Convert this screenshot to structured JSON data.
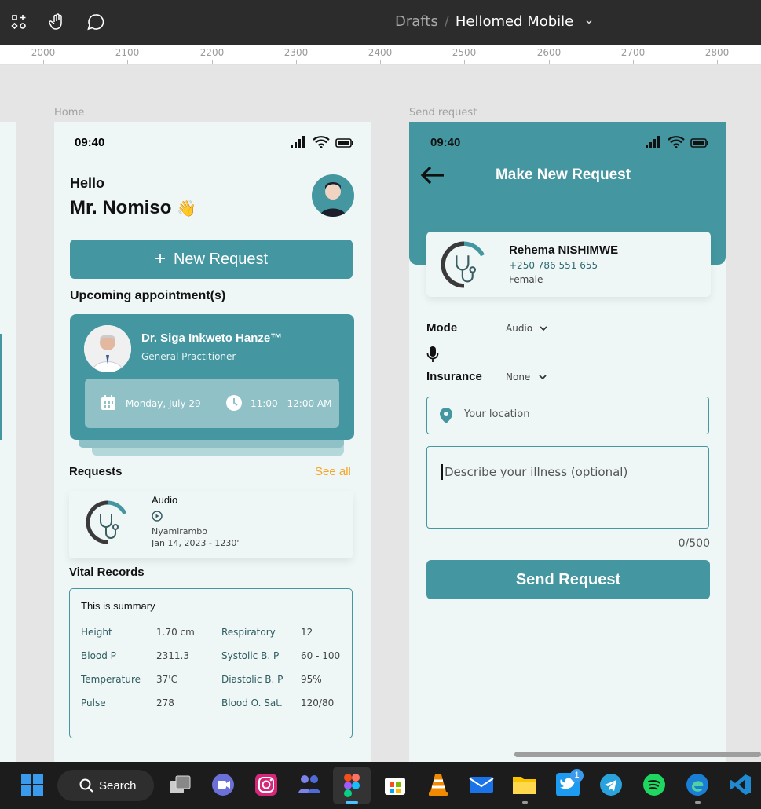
{
  "topbar": {
    "breadcrumb_drafts": "Drafts",
    "breadcrumb_sep": "/",
    "project_name": "Hellomed Mobile"
  },
  "ruler": {
    "ticks": [
      "2000",
      "2100",
      "2200",
      "2300",
      "2400",
      "2500",
      "2600",
      "2700",
      "2800"
    ]
  },
  "home": {
    "frame_label": "Home",
    "time": "09:40",
    "greeting": "Hello",
    "name": "Mr. Nomiso",
    "wave": "👋",
    "new_request_label": "New Request",
    "upcoming_title": "Upcoming appointment(s)",
    "doctor_name": "Dr. Siga Inkweto Hanze™",
    "doctor_role": "General Practitioner",
    "appt_date": "Monday, July 29",
    "appt_time": "11:00 - 12:00 AM",
    "requests_title": "Requests",
    "see_all": "See all",
    "request": {
      "type": "Audio",
      "location": "Nyamirambo",
      "datetime": "Jan 14, 2023 - 1230'"
    },
    "vitals_title": "Vital Records",
    "summary_title": "This is summary",
    "vitals": [
      {
        "label": "Height",
        "value": "1.70 cm",
        "label2": "Respiratory",
        "value2": "12"
      },
      {
        "label": "Blood P",
        "value": "2311.3",
        "label2": "Systolic B. P",
        "value2": "60 - 100"
      },
      {
        "label": "Temperature",
        "value": "37'C",
        "label2": "Diastolic B. P",
        "value2": "95%"
      },
      {
        "label": "Pulse",
        "value": "278",
        "label2": "Blood O. Sat.",
        "value2": "120/80"
      }
    ]
  },
  "send": {
    "frame_label": "Send request",
    "time": "09:40",
    "title": "Make New Request",
    "patient_name": "Rehema NISHIMWE",
    "patient_phone": "+250 786 551 655",
    "patient_gender": "Female",
    "mode_label": "Mode",
    "mode_value": "Audio",
    "insurance_label": "Insurance",
    "insurance_value": "None",
    "location_placeholder": "Your location",
    "illness_placeholder": "Describe your illness (optional)",
    "char_count": "0/500",
    "send_button": "Send Request"
  },
  "taskbar": {
    "search_label": "Search",
    "twitter_badge": "1"
  },
  "colors": {
    "teal": "#4497a0",
    "accent_orange": "#f5a623"
  }
}
